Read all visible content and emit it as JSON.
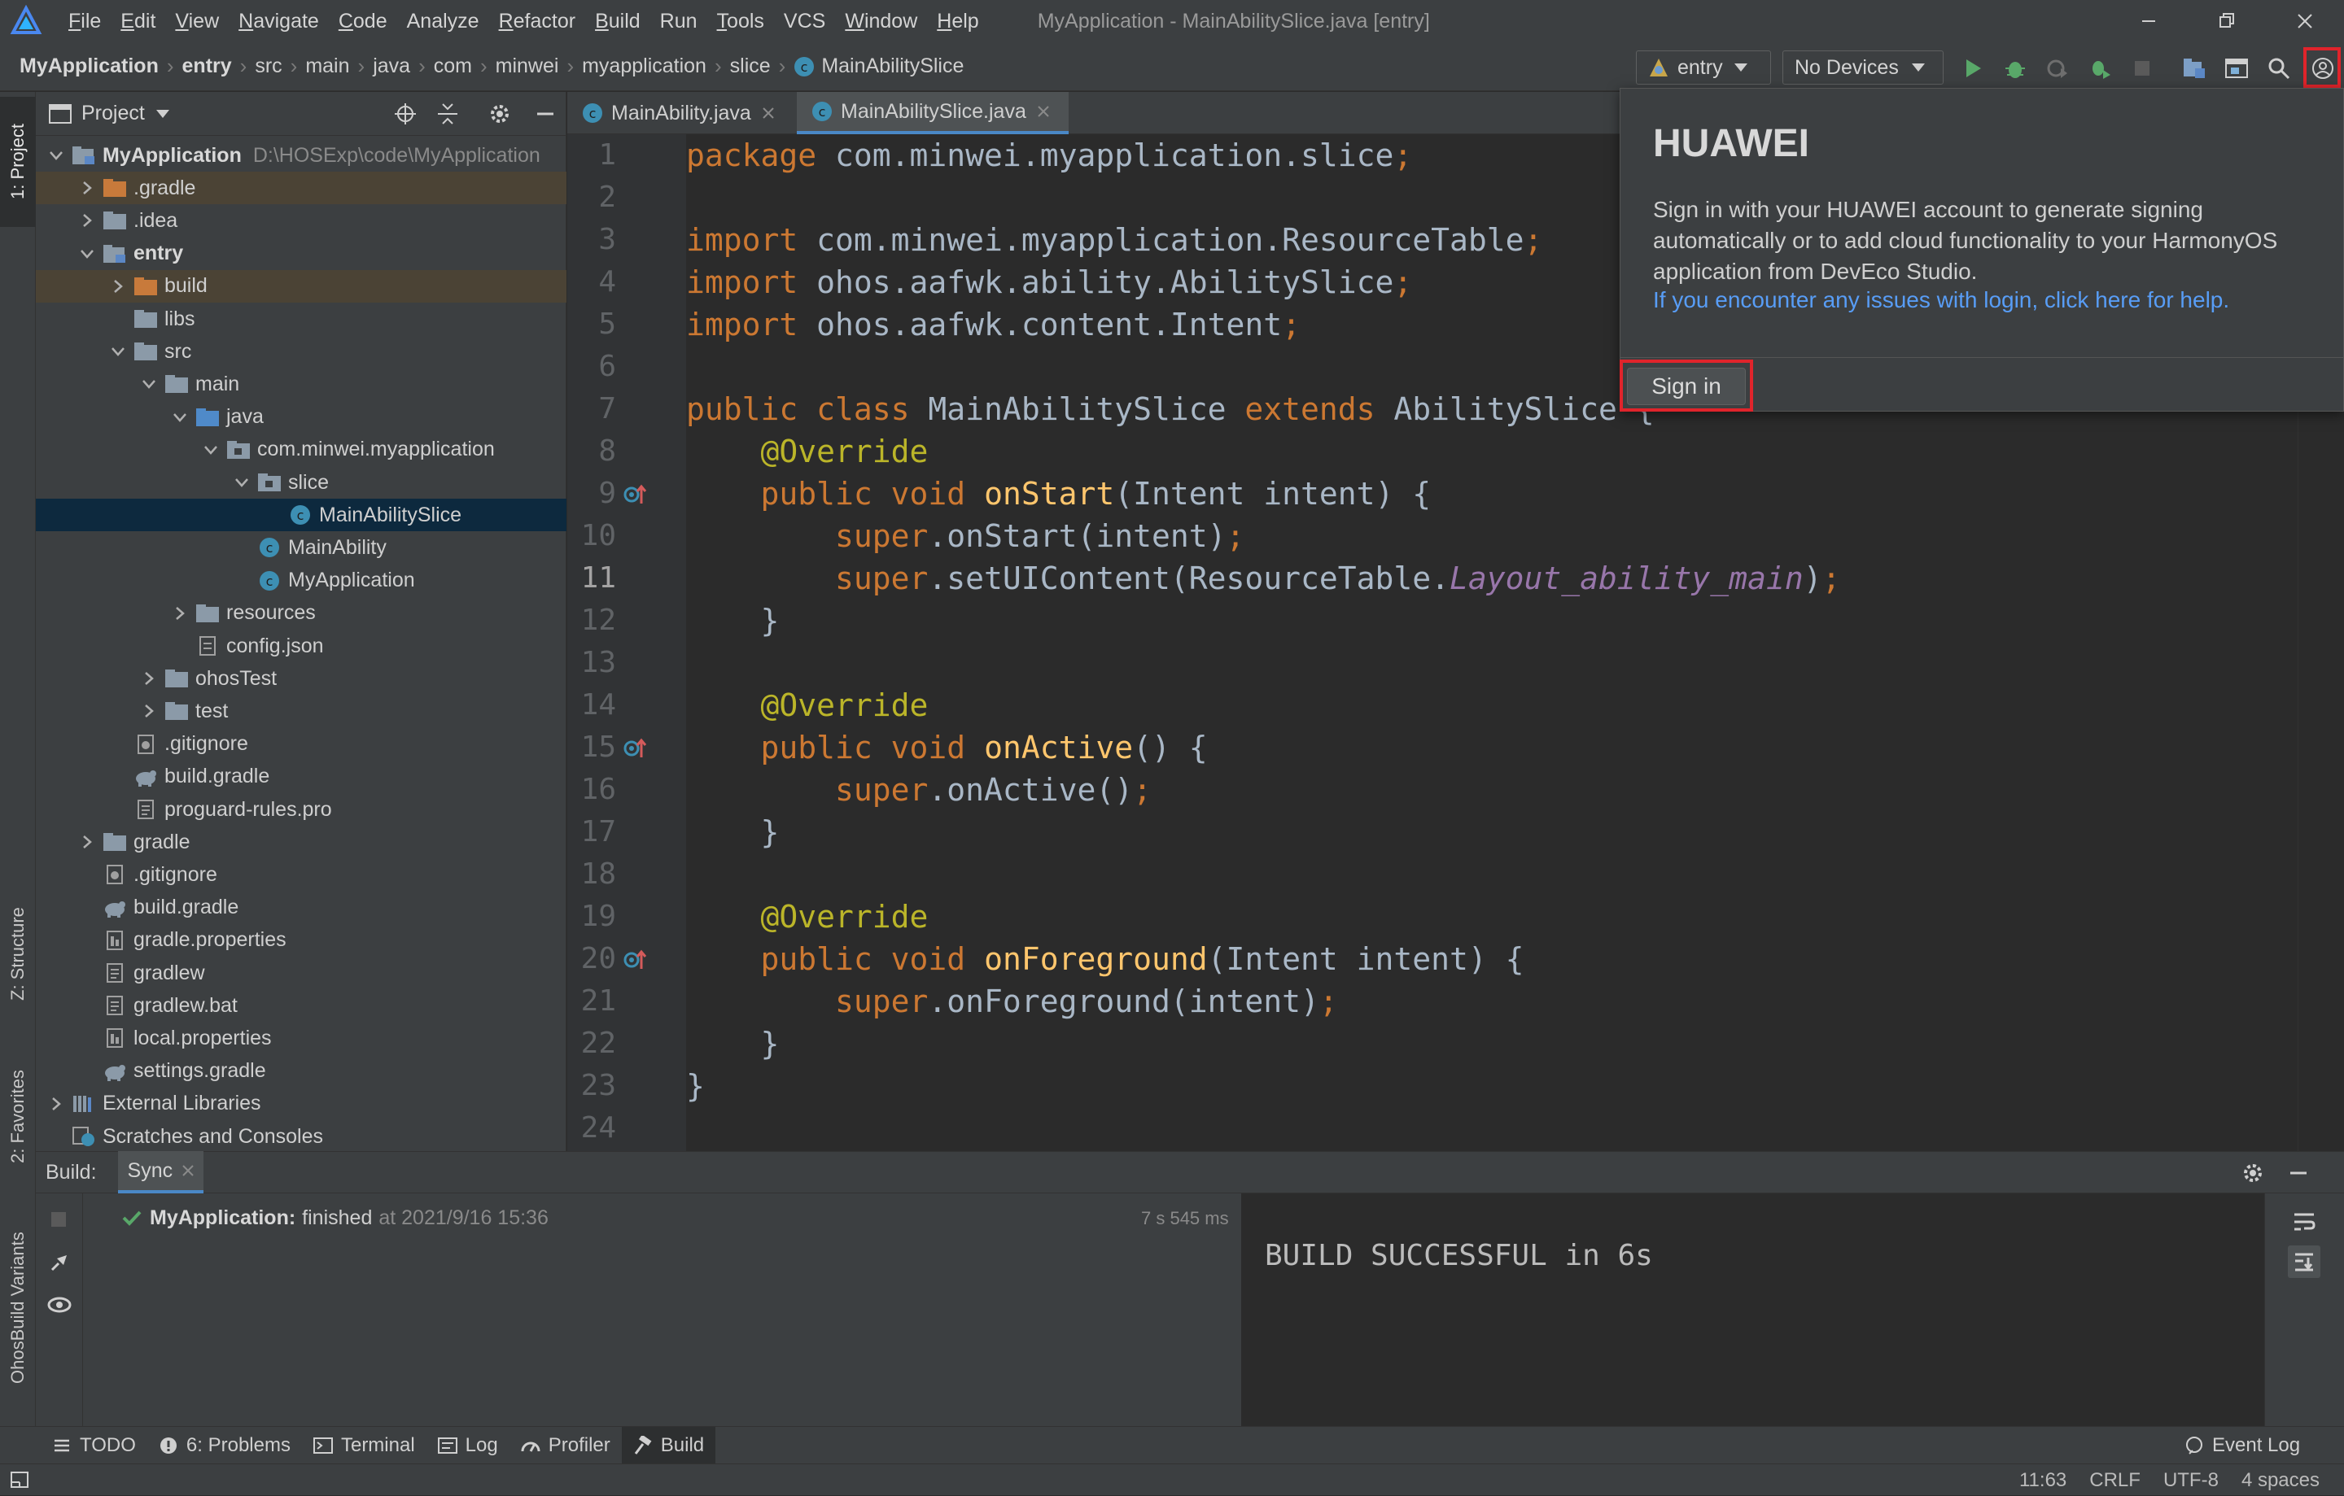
{
  "menubar": {
    "items": [
      {
        "label": "File",
        "u": "F",
        "rest": "ile"
      },
      {
        "label": "Edit",
        "u": "E",
        "rest": "dit"
      },
      {
        "label": "View",
        "u": "V",
        "rest": "iew"
      },
      {
        "label": "Navigate",
        "u": "N",
        "rest": "avigate"
      },
      {
        "label": "Code",
        "u": "C",
        "rest": "ode"
      },
      {
        "label": "Analyze",
        "u": "",
        "rest": "Analyze"
      },
      {
        "label": "Refactor",
        "u": "R",
        "rest": "efactor"
      },
      {
        "label": "Build",
        "u": "B",
        "rest": "uild"
      },
      {
        "label": "Run",
        "u": "",
        "rest": "Run"
      },
      {
        "label": "Tools",
        "u": "T",
        "rest": "ools"
      },
      {
        "label": "VCS",
        "u": "",
        "rest": "VCS"
      },
      {
        "label": "Window",
        "u": "W",
        "rest": "indow"
      },
      {
        "label": "Help",
        "u": "H",
        "rest": "elp"
      }
    ],
    "window_title": "MyApplication - MainAbilitySlice.java [entry]"
  },
  "breadcrumb": [
    "MyApplication",
    "entry",
    "src",
    "main",
    "java",
    "com",
    "minwei",
    "myapplication",
    "slice",
    "MainAbilitySlice"
  ],
  "toolbar": {
    "config_label": "entry",
    "devices_label": "No Devices"
  },
  "left_stripe": {
    "project_tab": "1: Project",
    "structure_tab": "Z: Structure",
    "favorites_tab": "2: Favorites",
    "variants_tab": "OhosBuild Variants"
  },
  "project_panel": {
    "title": "Project",
    "tree": [
      {
        "label": "MyApplication",
        "hint": "D:\\HOSExp\\code\\MyApplication",
        "bold": true
      },
      {
        "label": ".gradle"
      },
      {
        "label": ".idea"
      },
      {
        "label": "entry",
        "bold": true
      },
      {
        "label": "build"
      },
      {
        "label": "libs"
      },
      {
        "label": "src"
      },
      {
        "label": "main"
      },
      {
        "label": "java"
      },
      {
        "label": "com.minwei.myapplication"
      },
      {
        "label": "slice"
      },
      {
        "label": "MainAbilitySlice"
      },
      {
        "label": "MainAbility"
      },
      {
        "label": "MyApplication"
      },
      {
        "label": "resources"
      },
      {
        "label": "config.json"
      },
      {
        "label": "ohosTest"
      },
      {
        "label": "test"
      },
      {
        "label": ".gitignore"
      },
      {
        "label": "build.gradle"
      },
      {
        "label": "proguard-rules.pro"
      },
      {
        "label": "gradle"
      },
      {
        "label": ".gitignore"
      },
      {
        "label": "build.gradle"
      },
      {
        "label": "gradle.properties"
      },
      {
        "label": "gradlew"
      },
      {
        "label": "gradlew.bat"
      },
      {
        "label": "local.properties"
      },
      {
        "label": "settings.gradle"
      },
      {
        "label": "External Libraries"
      },
      {
        "label": "Scratches and Consoles"
      }
    ]
  },
  "editor": {
    "tabs": [
      "MainAbility.java",
      "MainAbilitySlice.java"
    ],
    "line_numbers": [
      "1",
      "2",
      "3",
      "4",
      "5",
      "6",
      "7",
      "8",
      "9",
      "10",
      "11",
      "12",
      "13",
      "14",
      "15",
      "16",
      "17",
      "18",
      "19",
      "20",
      "21",
      "22",
      "23",
      "24"
    ],
    "current_line": "11"
  },
  "popup": {
    "title": "HUAWEI",
    "message": "Sign in with your HUAWEI account to generate signing automatically or to add cloud functionality to your HarmonyOS application from DevEco Studio.",
    "link": "If you encounter any issues with login, click here for help.",
    "button": "Sign in"
  },
  "build_panel": {
    "label": "Build:",
    "tab": "Sync",
    "task_name": "MyApplication:",
    "task_status": "finished",
    "task_time": "at 2021/9/16 15:36",
    "duration": "7 s 545 ms",
    "console_output": "BUILD SUCCESSFUL in 6s"
  },
  "tool_windows": [
    {
      "label": "TODO",
      "icon": "list-icon"
    },
    {
      "label": "6: Problems",
      "icon": "info-icon"
    },
    {
      "label": "Terminal",
      "icon": "terminal-icon"
    },
    {
      "label": "Log",
      "icon": "log-icon"
    },
    {
      "label": "Profiler",
      "icon": "profiler-icon"
    },
    {
      "label": "Build",
      "icon": "hammer-icon"
    }
  ],
  "event_log": "Event Log",
  "status_bar": {
    "position": "11:63",
    "line_sep": "CRLF",
    "encoding": "UTF-8",
    "indent": "4 spaces"
  },
  "colors": {
    "accent_red": "#e0242b",
    "link_blue": "#589df6",
    "keyword": "#cc7832",
    "annotation": "#bbb529",
    "function": "#ffc66d",
    "static_field": "#9876aa"
  }
}
